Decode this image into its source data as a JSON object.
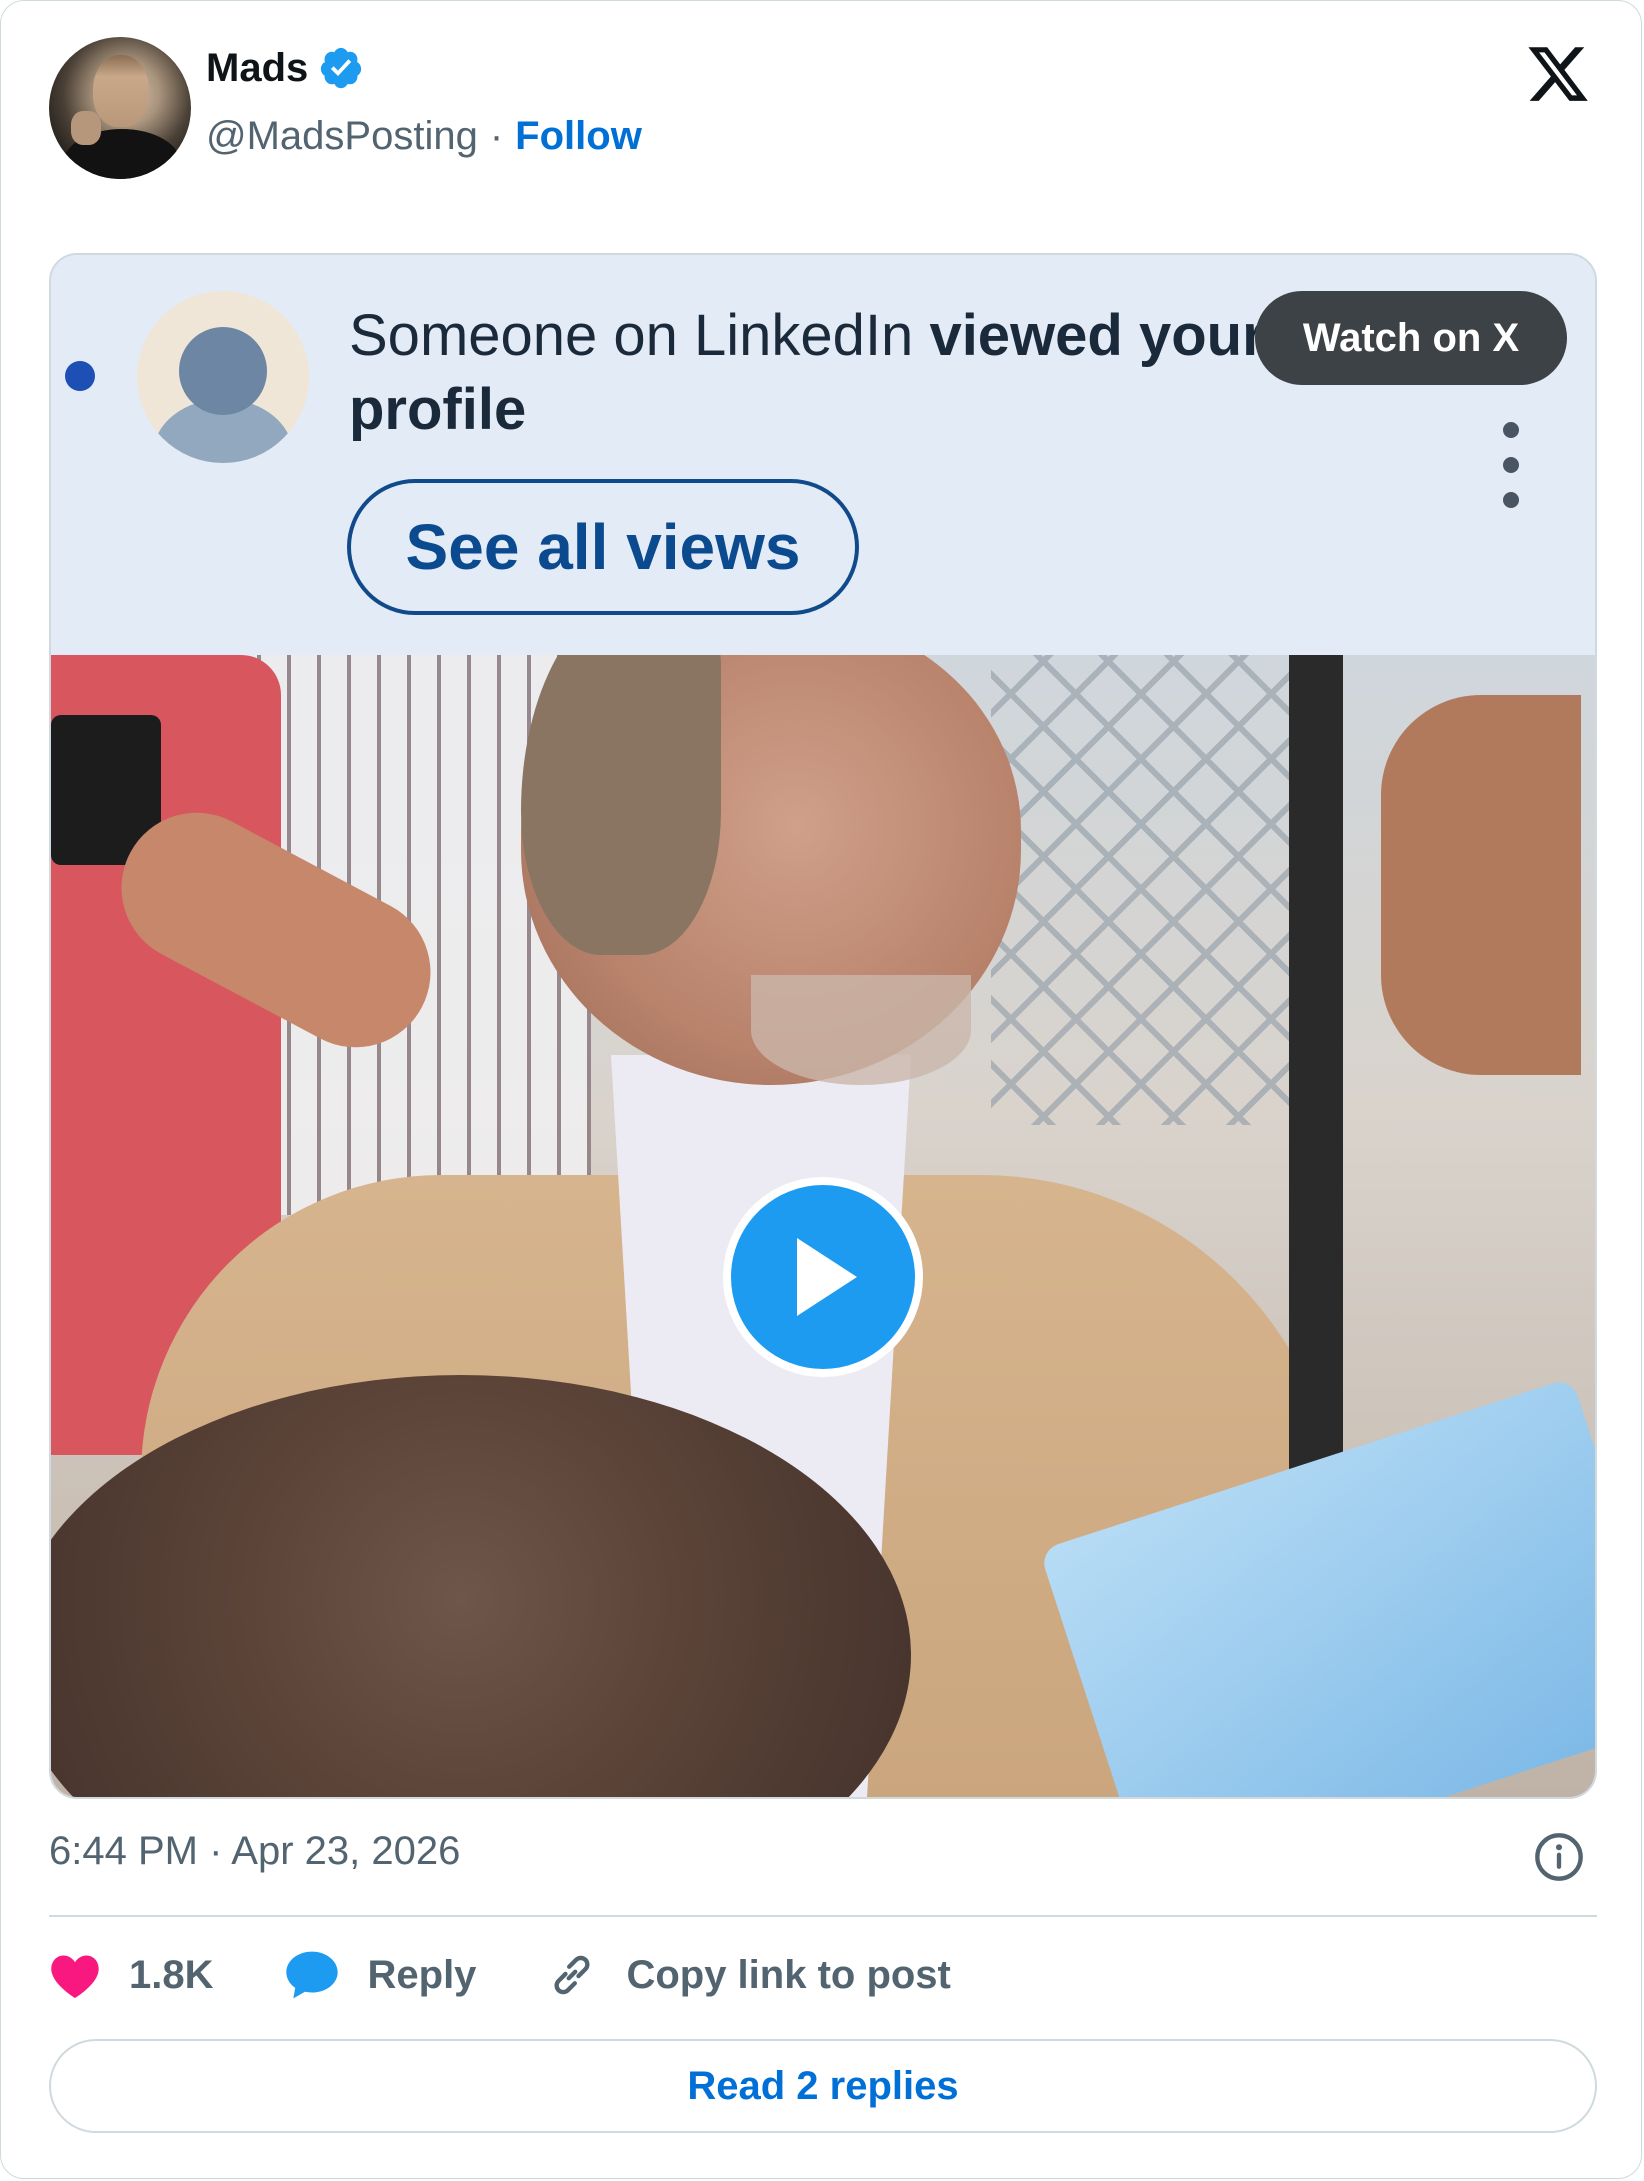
{
  "author": {
    "name": "Mads",
    "handle": "@MadsPosting",
    "separator": "·",
    "follow_label": "Follow"
  },
  "media": {
    "notification": {
      "text_prefix": "Someone on LinkedIn ",
      "text_bold": "viewed your",
      "text_line2": "profile",
      "button_label": "See all views"
    },
    "watch_on_x_label": "Watch on X"
  },
  "post": {
    "timestamp": "6:44 PM · Apr 23, 2026"
  },
  "actions": {
    "likes_count": "1.8K",
    "reply_label": "Reply",
    "copy_link_label": "Copy link to post",
    "read_replies_label": "Read 2 replies"
  },
  "colors": {
    "accent": "#1d9bf0",
    "link": "#006fd6",
    "like": "#f91880",
    "secondary_text": "#536471"
  },
  "icons": [
    "verified-badge-icon",
    "x-logo-icon",
    "kebab-menu-icon",
    "play-icon",
    "info-icon",
    "heart-icon",
    "reply-bubble-icon",
    "link-icon"
  ]
}
